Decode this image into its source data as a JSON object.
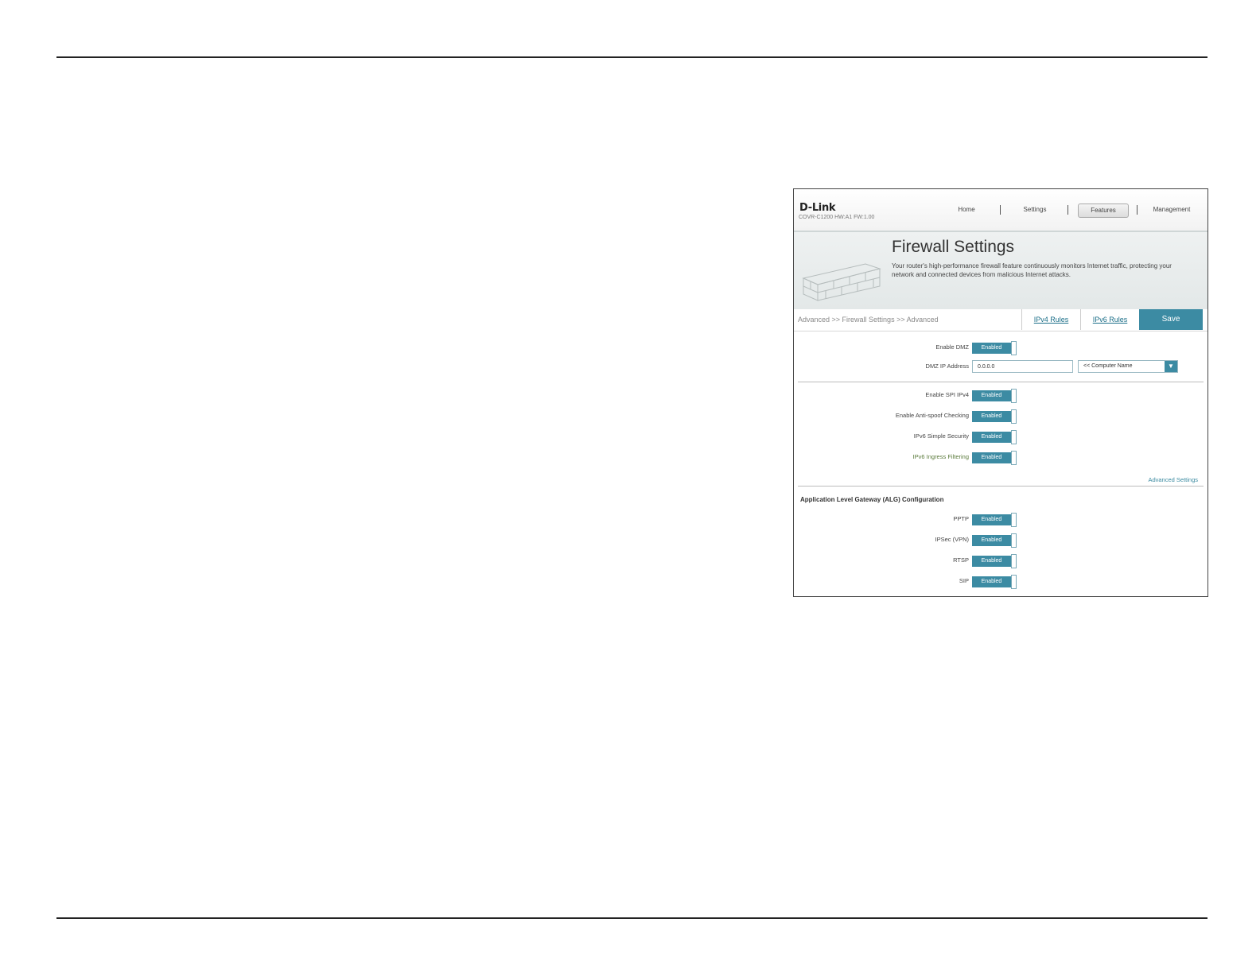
{
  "header": {
    "logo": "D-Link",
    "model": "COVR-C1200 HW:A1 FW:1.00",
    "nav": [
      "Home",
      "Settings",
      "Features",
      "Management"
    ],
    "active_nav": "Features"
  },
  "banner": {
    "title": "Firewall Settings",
    "description": "Your router's high-performance firewall feature continuously monitors Internet traffic, protecting your network and connected devices from malicious Internet attacks."
  },
  "breadcrumb": "Advanced >> Firewall Settings >> Advanced",
  "tabs": {
    "ipv4": "IPv4 Rules",
    "ipv6": "IPv6 Rules",
    "save": "Save"
  },
  "dmz": {
    "enable_label": "Enable DMZ",
    "enable_value": "Enabled",
    "ip_label": "DMZ IP Address",
    "ip_value": "0.0.0.0",
    "computer_select": "<< Computer Name"
  },
  "security": [
    {
      "label": "Enable SPI IPv4",
      "value": "Enabled"
    },
    {
      "label": "Enable Anti-spoof Checking",
      "value": "Enabled"
    },
    {
      "label": "IPv6 Simple Security",
      "value": "Enabled"
    },
    {
      "label": "IPv6 Ingress Filtering",
      "value": "Enabled"
    }
  ],
  "advanced_link": "Advanced Settings",
  "alg": {
    "title": "Application Level Gateway (ALG) Configuration",
    "items": [
      {
        "label": "PPTP",
        "value": "Enabled"
      },
      {
        "label": "IPSec (VPN)",
        "value": "Enabled"
      },
      {
        "label": "RTSP",
        "value": "Enabled"
      },
      {
        "label": "SIP",
        "value": "Enabled"
      }
    ]
  },
  "colors": {
    "accent": "#3c8ba3",
    "link": "#1a6e88"
  }
}
